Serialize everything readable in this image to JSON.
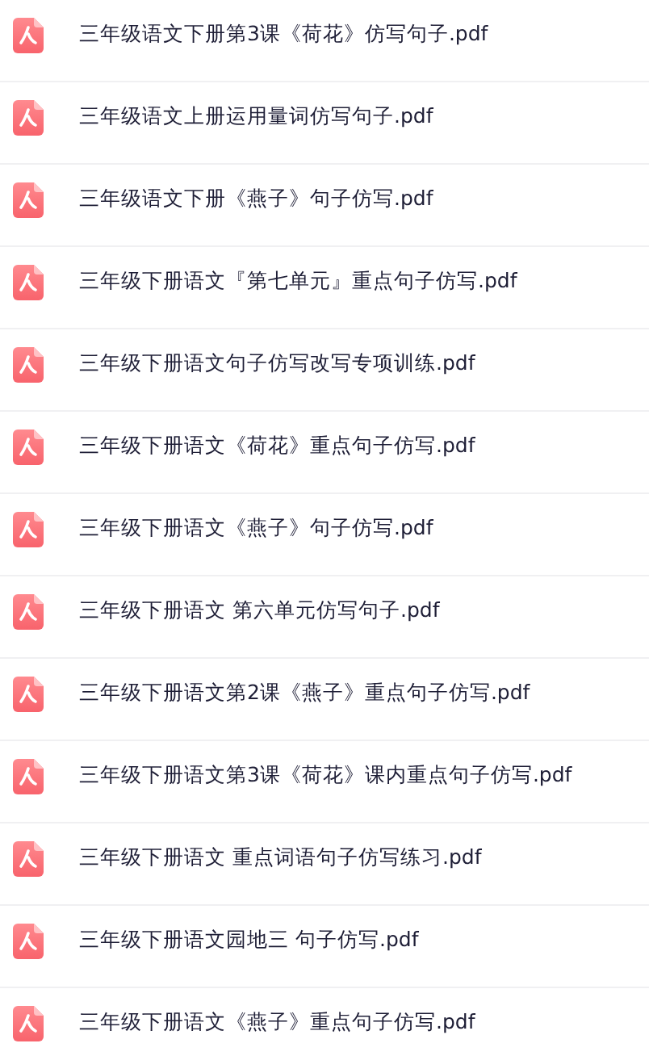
{
  "files": [
    {
      "name": "三年级语文下册第3课《荷花》仿写句子.pdf"
    },
    {
      "name": "三年级语文上册运用量词仿写句子.pdf"
    },
    {
      "name": "三年级语文下册《燕子》句子仿写.pdf"
    },
    {
      "name": "三年级下册语文『第七单元』重点句子仿写.pdf"
    },
    {
      "name": "三年级下册语文句子仿写改写专项训练.pdf"
    },
    {
      "name": "三年级下册语文《荷花》重点句子仿写.pdf"
    },
    {
      "name": "三年级下册语文《燕子》句子仿写.pdf"
    },
    {
      "name": "三年级下册语文 第六单元仿写句子.pdf"
    },
    {
      "name": "三年级下册语文第2课《燕子》重点句子仿写.pdf"
    },
    {
      "name": "三年级下册语文第3课《荷花》课内重点句子仿写.pdf"
    },
    {
      "name": "三年级下册语文 重点词语句子仿写练习.pdf"
    },
    {
      "name": "三年级下册语文园地三 句子仿写.pdf"
    },
    {
      "name": "三年级下册语文《燕子》重点句子仿写.pdf"
    }
  ]
}
